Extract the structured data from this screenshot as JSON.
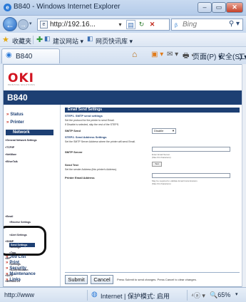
{
  "window": {
    "title": "B840 - Windows Internet Explorer",
    "min": "–",
    "max": "▭",
    "close": "✕"
  },
  "nav": {
    "back": "←",
    "forward": "→",
    "url": "http://192.16...",
    "search_placeholder": "Bing",
    "search_logo": "ᵦ"
  },
  "favorites": {
    "label": "收藏夹",
    "items": [
      {
        "label": "建议网站 ▾"
      },
      {
        "label": "网页快讯库 ▾"
      }
    ]
  },
  "tab": {
    "label": "B840"
  },
  "commandbar": {
    "home": "⌂",
    "feed": "▣ ▾",
    "mail": "✉ ▾",
    "print": "🖶 ▾",
    "page": "页面(P) ▾",
    "safety": "安全(S) ▾",
    "tools": "工具(O) ▾"
  },
  "page": {
    "logo": "OKI",
    "logo_tag": "PRINTING SOLUTIONS",
    "model": "B840",
    "nav_top": [
      {
        "label": "Status"
      },
      {
        "label": "Printer"
      }
    ],
    "nav_network": "Network",
    "nav_sub": [
      "General Network Settings",
      "TCP/IP",
      "NetWare",
      "EtherTalk"
    ],
    "nav_email": "Email",
    "nav_email_sub": [
      "Receive Settings",
      "Send Settings",
      "Alert Settings"
    ],
    "nav_mid": [
      "SNMP",
      "Settings",
      "Trap",
      "IPP",
      "Settings",
      "Authentication",
      "SNTP",
      "IEEE802.1X"
    ],
    "nav_bottom": [
      {
        "label": "Job List"
      },
      {
        "label": "Print"
      },
      {
        "label": "Security"
      },
      {
        "label": "Maintenance"
      },
      {
        "label": "Links"
      }
    ],
    "section_title": "Email Send Settings",
    "step1": "STEP1. SMTP send settings",
    "step1_desc": "Set the protocol for the printer to send Email.",
    "step1_desc2": "If Disable is selected, skip the rest of the STEPS.",
    "smtp_send_label": "SMTP Send",
    "smtp_send_value": "Disable",
    "step2": "STEP2. Send Address Settings",
    "step2_desc": "Set the SMTP Server Address where the printer will send Email.",
    "smtp_server_label": "SMTP Server",
    "smtp_server_hint": "Enter Email Server.",
    "smtp_server_hint2": "(Max 64 characters)",
    "send_test_label": "Send Test",
    "send_test_btn": "Test",
    "sender_desc": "Set the sender Address (this printer's Address).",
    "printer_email_label": "Printer Email Address",
    "printer_email_hint": "May be required to validate Email transmissions",
    "printer_email_hint2": "(Max 64 characters)",
    "submit": "Submit",
    "cancel": "Cancel",
    "action_note": "Press Submit to send changes. Press Cancel to clear changes."
  },
  "status": {
    "url": "http://www",
    "zone": "Internet | 保护模式: 启用",
    "tools": "⁴ⓐ ▾",
    "zoom": "🔍65%",
    "drop": "▾"
  }
}
